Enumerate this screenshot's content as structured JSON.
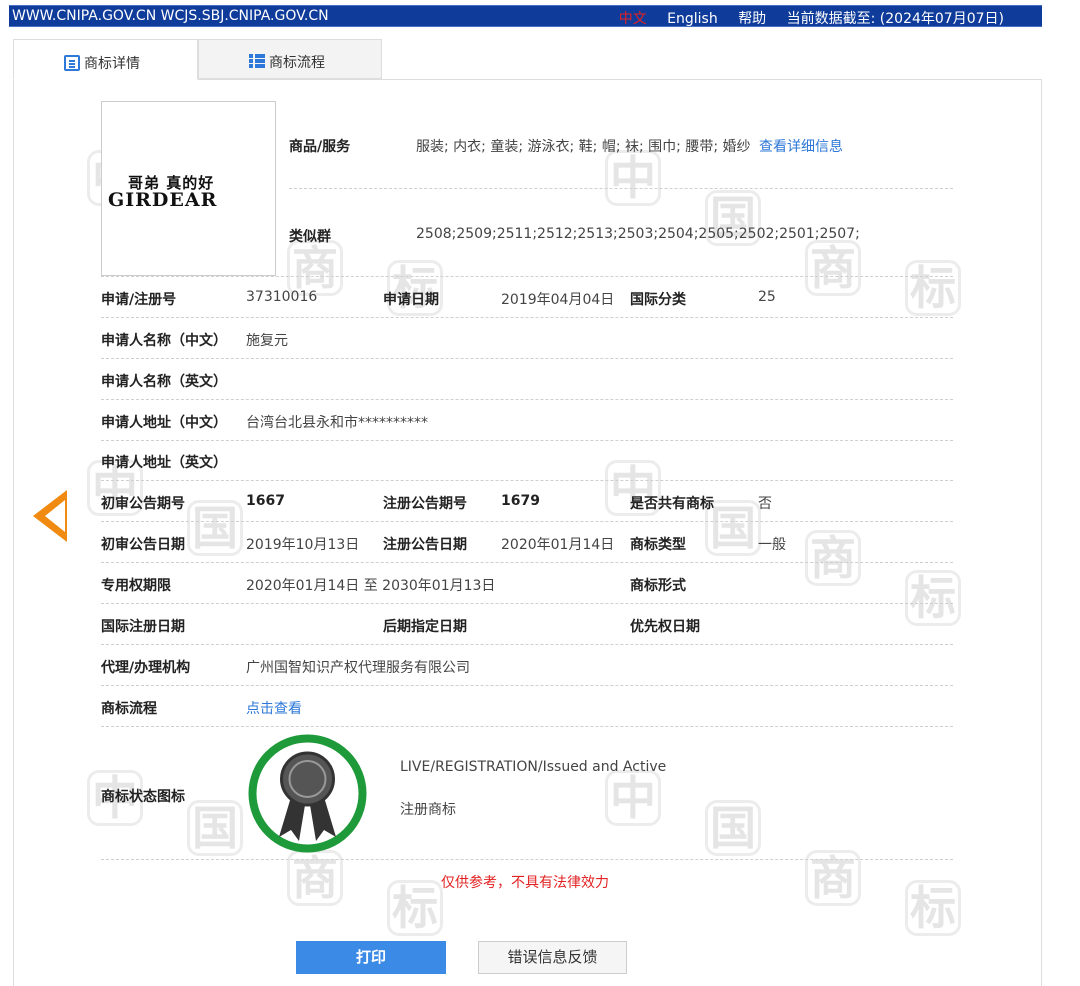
{
  "topbar": {
    "site": "WWW.CNIPA.GOV.CN WCJS.SBJ.CNIPA.GOV.CN",
    "lang_cn": "中文",
    "lang_en": "English",
    "help": "帮助",
    "data_date": "当前数据截至: (2024年07月07日)"
  },
  "tabs": {
    "detail": "商标详情",
    "flow": "商标流程"
  },
  "logo": {
    "cn_text": "哥弟 真的好",
    "en_text": "GIRDEAR"
  },
  "goods": {
    "label": "商品/服务",
    "value": "服装; 内衣; 童装; 游泳衣; 鞋; 帽; 袜; 围巾; 腰带; 婚纱",
    "link": "查看详细信息"
  },
  "similar": {
    "label": "类似群",
    "value": "2508;2509;2511;2512;2513;2503;2504;2505;2502;2501;2507;"
  },
  "fields": {
    "reg_no_label": "申请/注册号",
    "reg_no": "37310016",
    "apply_date_label": "申请日期",
    "apply_date": "2019年04月04日",
    "intl_class_label": "国际分类",
    "intl_class": "25",
    "applicant_cn_label": "申请人名称（中文）",
    "applicant_cn": "施复元",
    "applicant_en_label": "申请人名称（英文）",
    "address_cn_label": "申请人地址（中文）",
    "address_cn": "台湾台北县永和市**********",
    "address_en_label": "申请人地址（英文）",
    "prelim_no_label": "初审公告期号",
    "prelim_no": "1667",
    "reg_pub_no_label": "注册公告期号",
    "reg_pub_no": "1679",
    "shared_label": "是否共有商标",
    "shared": "否",
    "prelim_date_label": "初审公告日期",
    "prelim_date": "2019年10月13日",
    "reg_pub_date_label": "注册公告日期",
    "reg_pub_date": "2020年01月14日",
    "tm_type_label": "商标类型",
    "tm_type": "一般",
    "term_label": "专用权期限",
    "term": "2020年01月14日 至 2030年01月13日",
    "tm_form_label": "商标形式",
    "intl_reg_date_label": "国际注册日期",
    "later_designation_label": "后期指定日期",
    "priority_date_label": "优先权日期",
    "agent_label": "代理/办理机构",
    "agent": "广州国智知识产权代理服务有限公司",
    "flow_label": "商标流程",
    "flow_link": "点击查看",
    "status_label": "商标状态图标",
    "status_en": "LIVE/REGISTRATION/Issued and Active",
    "status_cn": "注册商标"
  },
  "disclaimer": "仅供参考，不具有法律效力",
  "buttons": {
    "print": "打印",
    "feedback": "错误信息反馈"
  },
  "colors": {
    "topbar_bg": "#0f3b9a",
    "accent_blue": "#2d78d8",
    "arrow_orange": "#f08a10",
    "disclaimer_red": "#e32222",
    "status_green": "#1e9a3a"
  },
  "watermark": {
    "glyphs": [
      "中",
      "国",
      "商",
      "标"
    ]
  }
}
